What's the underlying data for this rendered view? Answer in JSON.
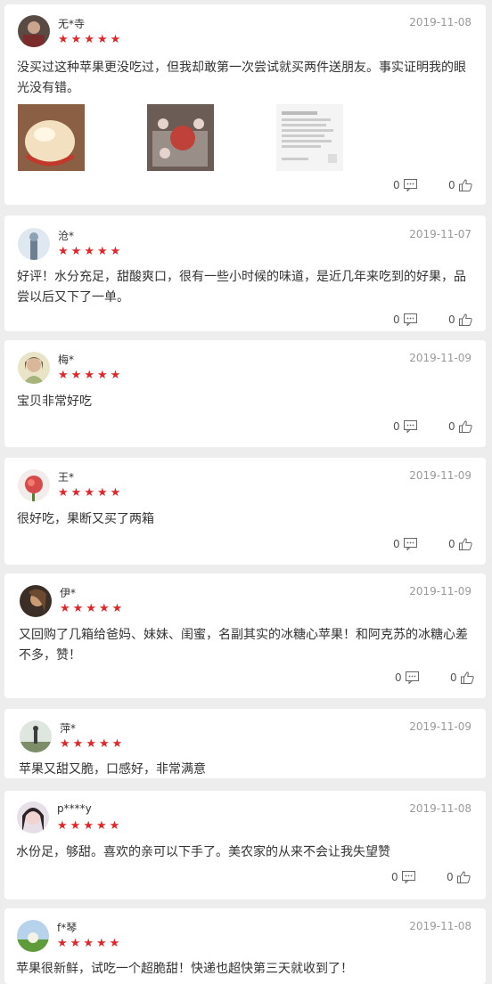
{
  "colors": {
    "star": "#e0262b",
    "date": "#999999",
    "background": "#ededed"
  },
  "star_glyph": "★",
  "reviews": [
    {
      "user": "无*寺",
      "date": "2019-11-08",
      "rating": 5,
      "text": "没买过这种苹果更没吃过，但我却敢第一次尝试就买两件送朋友。事实证明我的眼光没有错。",
      "photos": [
        "apple-slice-photo",
        "apple-box-photo",
        "chat-screenshot-photo"
      ],
      "comment_count": "0",
      "like_count": "0"
    },
    {
      "user": "沧*",
      "date": "2019-11-07",
      "rating": 5,
      "text": "好评！水分充足，甜酸爽口，很有一些小时候的味道，是近几年来吃到的好果，品尝以后又下了一单。",
      "comment_count": "0",
      "like_count": "0"
    },
    {
      "user": "梅*",
      "date": "2019-11-09",
      "rating": 5,
      "text": "宝贝非常好吃",
      "comment_count": "0",
      "like_count": "0"
    },
    {
      "user": "王*",
      "date": "2019-11-09",
      "rating": 5,
      "text": "很好吃，果断又买了两箱",
      "comment_count": "0",
      "like_count": "0"
    },
    {
      "user": "伊*",
      "date": "2019-11-09",
      "rating": 5,
      "text": "又回购了几箱给爸妈、妹妹、闺蜜，名副其实的冰糖心苹果！和阿克苏的冰糖心差不多，赞！",
      "comment_count": "0",
      "like_count": "0"
    },
    {
      "user": "萍*",
      "date": "2019-11-09",
      "rating": 5,
      "text": "苹果又甜又脆，口感好，非常满意"
    },
    {
      "user": "p****y",
      "date": "2019-11-08",
      "rating": 5,
      "text": "水份足，够甜。喜欢的亲可以下手了。美农家的从来不会让我失望赞",
      "comment_count": "0",
      "like_count": "0"
    },
    {
      "user": "f*琴",
      "date": "2019-11-08",
      "rating": 5,
      "text": "苹果很新鲜，试吃一个超脆甜！快递也超快第三天就收到了！"
    }
  ]
}
